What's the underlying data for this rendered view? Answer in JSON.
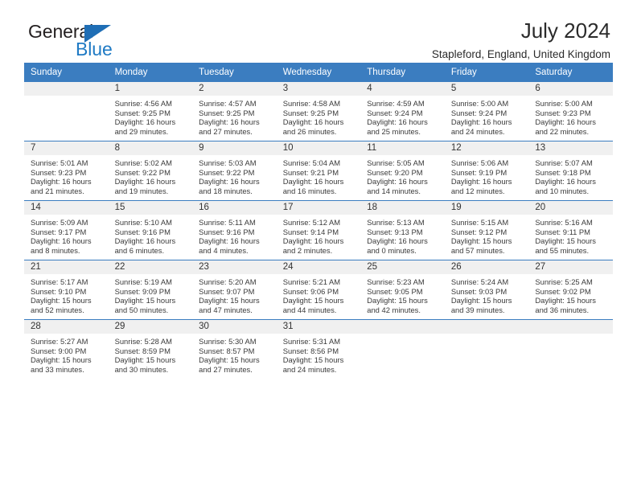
{
  "brand": {
    "name_part1": "General",
    "name_part2": "Blue",
    "accent_color": "#1f6eb5"
  },
  "header": {
    "title": "July 2024",
    "subtitle": "Stapleford, England, United Kingdom"
  },
  "calendar": {
    "header_bg": "#3b7dc0",
    "day_band_bg": "#f0f0f0",
    "weekday_headers": [
      "Sunday",
      "Monday",
      "Tuesday",
      "Wednesday",
      "Thursday",
      "Friday",
      "Saturday"
    ],
    "weeks": [
      [
        {
          "day": "",
          "lines": []
        },
        {
          "day": "1",
          "lines": [
            "Sunrise: 4:56 AM",
            "Sunset: 9:25 PM",
            "Daylight: 16 hours",
            "and 29 minutes."
          ]
        },
        {
          "day": "2",
          "lines": [
            "Sunrise: 4:57 AM",
            "Sunset: 9:25 PM",
            "Daylight: 16 hours",
            "and 27 minutes."
          ]
        },
        {
          "day": "3",
          "lines": [
            "Sunrise: 4:58 AM",
            "Sunset: 9:25 PM",
            "Daylight: 16 hours",
            "and 26 minutes."
          ]
        },
        {
          "day": "4",
          "lines": [
            "Sunrise: 4:59 AM",
            "Sunset: 9:24 PM",
            "Daylight: 16 hours",
            "and 25 minutes."
          ]
        },
        {
          "day": "5",
          "lines": [
            "Sunrise: 5:00 AM",
            "Sunset: 9:24 PM",
            "Daylight: 16 hours",
            "and 24 minutes."
          ]
        },
        {
          "day": "6",
          "lines": [
            "Sunrise: 5:00 AM",
            "Sunset: 9:23 PM",
            "Daylight: 16 hours",
            "and 22 minutes."
          ]
        }
      ],
      [
        {
          "day": "7",
          "lines": [
            "Sunrise: 5:01 AM",
            "Sunset: 9:23 PM",
            "Daylight: 16 hours",
            "and 21 minutes."
          ]
        },
        {
          "day": "8",
          "lines": [
            "Sunrise: 5:02 AM",
            "Sunset: 9:22 PM",
            "Daylight: 16 hours",
            "and 19 minutes."
          ]
        },
        {
          "day": "9",
          "lines": [
            "Sunrise: 5:03 AM",
            "Sunset: 9:22 PM",
            "Daylight: 16 hours",
            "and 18 minutes."
          ]
        },
        {
          "day": "10",
          "lines": [
            "Sunrise: 5:04 AM",
            "Sunset: 9:21 PM",
            "Daylight: 16 hours",
            "and 16 minutes."
          ]
        },
        {
          "day": "11",
          "lines": [
            "Sunrise: 5:05 AM",
            "Sunset: 9:20 PM",
            "Daylight: 16 hours",
            "and 14 minutes."
          ]
        },
        {
          "day": "12",
          "lines": [
            "Sunrise: 5:06 AM",
            "Sunset: 9:19 PM",
            "Daylight: 16 hours",
            "and 12 minutes."
          ]
        },
        {
          "day": "13",
          "lines": [
            "Sunrise: 5:07 AM",
            "Sunset: 9:18 PM",
            "Daylight: 16 hours",
            "and 10 minutes."
          ]
        }
      ],
      [
        {
          "day": "14",
          "lines": [
            "Sunrise: 5:09 AM",
            "Sunset: 9:17 PM",
            "Daylight: 16 hours",
            "and 8 minutes."
          ]
        },
        {
          "day": "15",
          "lines": [
            "Sunrise: 5:10 AM",
            "Sunset: 9:16 PM",
            "Daylight: 16 hours",
            "and 6 minutes."
          ]
        },
        {
          "day": "16",
          "lines": [
            "Sunrise: 5:11 AM",
            "Sunset: 9:16 PM",
            "Daylight: 16 hours",
            "and 4 minutes."
          ]
        },
        {
          "day": "17",
          "lines": [
            "Sunrise: 5:12 AM",
            "Sunset: 9:14 PM",
            "Daylight: 16 hours",
            "and 2 minutes."
          ]
        },
        {
          "day": "18",
          "lines": [
            "Sunrise: 5:13 AM",
            "Sunset: 9:13 PM",
            "Daylight: 16 hours",
            "and 0 minutes."
          ]
        },
        {
          "day": "19",
          "lines": [
            "Sunrise: 5:15 AM",
            "Sunset: 9:12 PM",
            "Daylight: 15 hours",
            "and 57 minutes."
          ]
        },
        {
          "day": "20",
          "lines": [
            "Sunrise: 5:16 AM",
            "Sunset: 9:11 PM",
            "Daylight: 15 hours",
            "and 55 minutes."
          ]
        }
      ],
      [
        {
          "day": "21",
          "lines": [
            "Sunrise: 5:17 AM",
            "Sunset: 9:10 PM",
            "Daylight: 15 hours",
            "and 52 minutes."
          ]
        },
        {
          "day": "22",
          "lines": [
            "Sunrise: 5:19 AM",
            "Sunset: 9:09 PM",
            "Daylight: 15 hours",
            "and 50 minutes."
          ]
        },
        {
          "day": "23",
          "lines": [
            "Sunrise: 5:20 AM",
            "Sunset: 9:07 PM",
            "Daylight: 15 hours",
            "and 47 minutes."
          ]
        },
        {
          "day": "24",
          "lines": [
            "Sunrise: 5:21 AM",
            "Sunset: 9:06 PM",
            "Daylight: 15 hours",
            "and 44 minutes."
          ]
        },
        {
          "day": "25",
          "lines": [
            "Sunrise: 5:23 AM",
            "Sunset: 9:05 PM",
            "Daylight: 15 hours",
            "and 42 minutes."
          ]
        },
        {
          "day": "26",
          "lines": [
            "Sunrise: 5:24 AM",
            "Sunset: 9:03 PM",
            "Daylight: 15 hours",
            "and 39 minutes."
          ]
        },
        {
          "day": "27",
          "lines": [
            "Sunrise: 5:25 AM",
            "Sunset: 9:02 PM",
            "Daylight: 15 hours",
            "and 36 minutes."
          ]
        }
      ],
      [
        {
          "day": "28",
          "lines": [
            "Sunrise: 5:27 AM",
            "Sunset: 9:00 PM",
            "Daylight: 15 hours",
            "and 33 minutes."
          ]
        },
        {
          "day": "29",
          "lines": [
            "Sunrise: 5:28 AM",
            "Sunset: 8:59 PM",
            "Daylight: 15 hours",
            "and 30 minutes."
          ]
        },
        {
          "day": "30",
          "lines": [
            "Sunrise: 5:30 AM",
            "Sunset: 8:57 PM",
            "Daylight: 15 hours",
            "and 27 minutes."
          ]
        },
        {
          "day": "31",
          "lines": [
            "Sunrise: 5:31 AM",
            "Sunset: 8:56 PM",
            "Daylight: 15 hours",
            "and 24 minutes."
          ]
        },
        {
          "day": "",
          "lines": []
        },
        {
          "day": "",
          "lines": []
        },
        {
          "day": "",
          "lines": []
        }
      ]
    ]
  }
}
